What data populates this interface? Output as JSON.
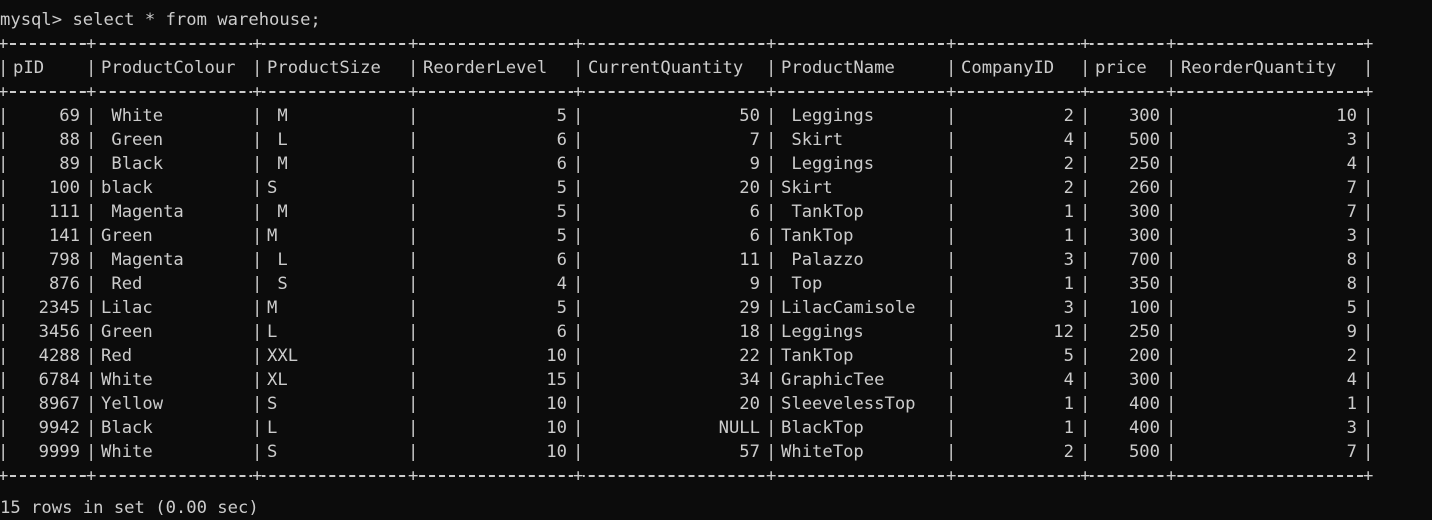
{
  "prompt": {
    "prefix": "mysql> ",
    "command": "select * from warehouse;"
  },
  "table": {
    "columns": [
      "pID",
      "ProductColour",
      "ProductSize",
      "ReorderLevel",
      "CurrentQuantity",
      "ProductName",
      "CompanyID",
      "price",
      "ReorderQuantity"
    ],
    "rows": [
      [
        "69",
        " White",
        " M",
        "5",
        "50",
        " Leggings",
        "2",
        "300",
        "10"
      ],
      [
        "88",
        " Green",
        " L",
        "6",
        "7",
        " Skirt",
        "4",
        "500",
        "3"
      ],
      [
        "89",
        " Black",
        " M",
        "6",
        "9",
        " Leggings",
        "2",
        "250",
        "4"
      ],
      [
        "100",
        "black",
        "S",
        "5",
        "20",
        "Skirt",
        "2",
        "260",
        "7"
      ],
      [
        "111",
        " Magenta",
        " M",
        "5",
        "6",
        " TankTop",
        "1",
        "300",
        "7"
      ],
      [
        "141",
        "Green",
        "M",
        "5",
        "6",
        "TankTop",
        "1",
        "300",
        "3"
      ],
      [
        "798",
        " Magenta",
        " L",
        "6",
        "11",
        " Palazzo",
        "3",
        "700",
        "8"
      ],
      [
        "876",
        " Red",
        " S",
        "4",
        "9",
        " Top",
        "1",
        "350",
        "8"
      ],
      [
        "2345",
        "Lilac",
        "M",
        "5",
        "29",
        "LilacCamisole",
        "3",
        "100",
        "5"
      ],
      [
        "3456",
        "Green",
        "L",
        "6",
        "18",
        "Leggings",
        "12",
        "250",
        "9"
      ],
      [
        "4288",
        "Red",
        "XXL",
        "10",
        "22",
        "TankTop",
        "5",
        "200",
        "2"
      ],
      [
        "6784",
        "White",
        "XL",
        "15",
        "34",
        "GraphicTee",
        "4",
        "300",
        "4"
      ],
      [
        "8967",
        "Yellow",
        "S",
        "10",
        "20",
        "SleevelessTop",
        "1",
        "400",
        "1"
      ],
      [
        "9942",
        "Black",
        "L",
        "10",
        "NULL",
        "BlackTop",
        "1",
        "400",
        "3"
      ],
      [
        "9999",
        "White",
        "S",
        "10",
        "57",
        "WhiteTop",
        "2",
        "500",
        "7"
      ]
    ],
    "align": [
      "r",
      "l",
      "l",
      "r",
      "r",
      "l",
      "r",
      "r",
      "r"
    ]
  },
  "footer": {
    "summary": "15 rows in set (0.00 sec)"
  },
  "colors": {
    "background": "#0c0c0c",
    "text": "#cccccc"
  }
}
